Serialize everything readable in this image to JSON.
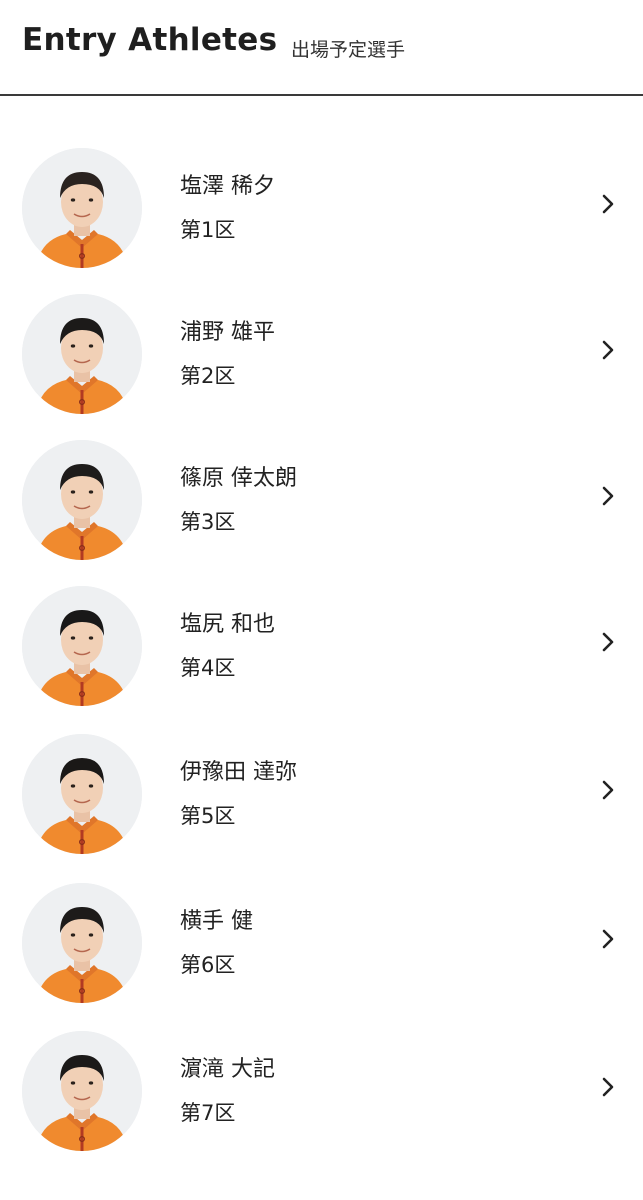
{
  "header": {
    "title": "Entry Athletes",
    "subtitle": "出場予定選手"
  },
  "colors": {
    "accent": "#f08a2e",
    "avatar_bg": "#eef0f2",
    "divider": "#3a3a3a"
  },
  "athletes": [
    {
      "name": "塩澤 稀夕",
      "section": "第1区"
    },
    {
      "name": "浦野 雄平",
      "section": "第2区"
    },
    {
      "name": "篠原 倖太朗",
      "section": "第3区"
    },
    {
      "name": "塩尻 和也",
      "section": "第4区"
    },
    {
      "name": "伊豫田 達弥",
      "section": "第5区"
    },
    {
      "name": "横手 健",
      "section": "第6区"
    },
    {
      "name": "濵滝 大記",
      "section": "第7区"
    }
  ]
}
